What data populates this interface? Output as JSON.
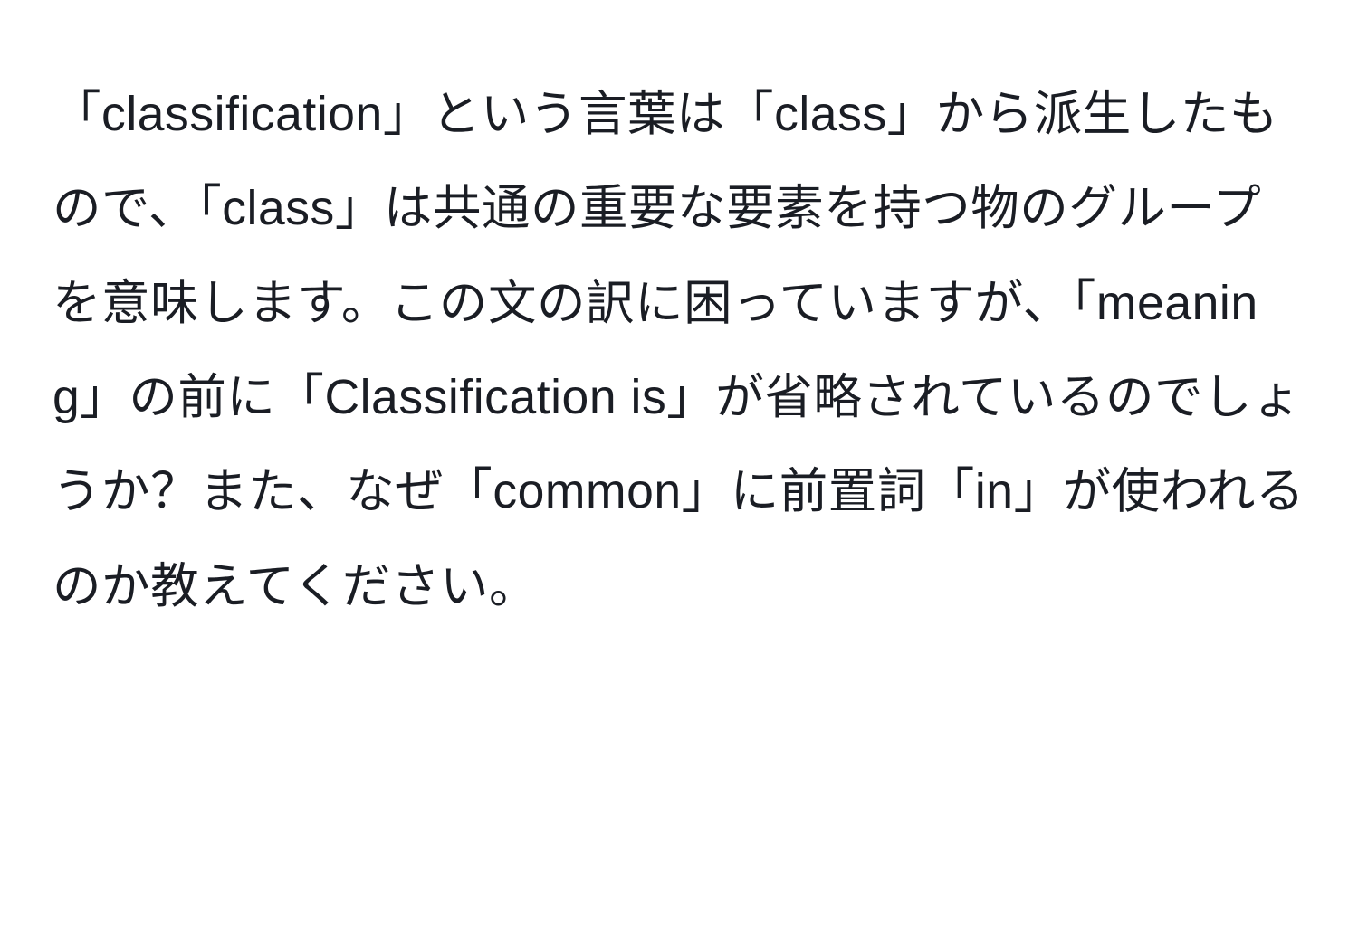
{
  "content": {
    "paragraph": "「classification」という言葉は「class」から派生したもので、「class」は共通の重要な要素を持つ物のグループを意味します。この文の訳に困っていますが、「meaning」の前に「Classification is」が省略されているのでしょうか？また、なぜ「common」に前置詞「in」が使われるのか教えてください。"
  }
}
